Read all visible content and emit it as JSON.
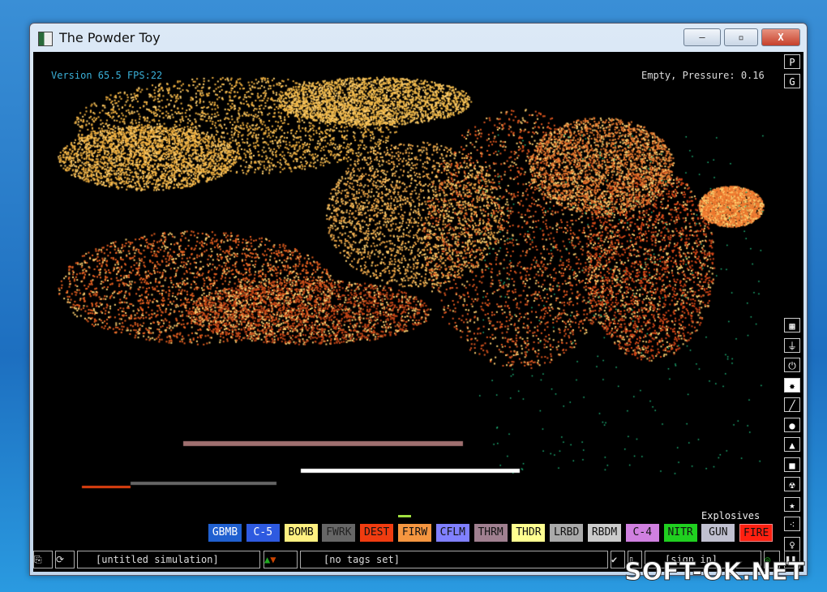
{
  "window": {
    "title": "The Powder Toy",
    "minimize": "–",
    "maximize": "▫",
    "close": "X"
  },
  "hud": {
    "version": "Version 65.5 FPS:22",
    "status": "Empty, Pressure: 0.16"
  },
  "side_top": [
    "P",
    "G"
  ],
  "side_tools": [
    {
      "icon": "wall-icon",
      "glyph": "▦"
    },
    {
      "icon": "electronics-plug-icon",
      "glyph": "⏚"
    },
    {
      "icon": "power-icon",
      "glyph": "⏻"
    },
    {
      "icon": "explosives-icon",
      "glyph": "✸"
    },
    {
      "icon": "gas-pen-icon",
      "glyph": "╱"
    },
    {
      "icon": "liquid-drop-icon",
      "glyph": "●"
    },
    {
      "icon": "powder-icon",
      "glyph": "▲"
    },
    {
      "icon": "solid-icon",
      "glyph": "■"
    },
    {
      "icon": "radioactive-icon",
      "glyph": "☢"
    },
    {
      "icon": "special-star-icon",
      "glyph": "★"
    },
    {
      "icon": "particles-icon",
      "glyph": "⁖"
    },
    {
      "icon": "life-icon",
      "glyph": "♀"
    }
  ],
  "category": "Explosives",
  "elements": [
    {
      "label": "GBMB",
      "bg": "#2060d0",
      "fg": "#ffffff"
    },
    {
      "label": "C-5",
      "bg": "#2e5ae0",
      "fg": "#ffffff"
    },
    {
      "label": "BOMB",
      "bg": "#fff080",
      "fg": "#000000"
    },
    {
      "label": "FWRK",
      "bg": "#666666",
      "fg": "#222222"
    },
    {
      "label": "DEST",
      "bg": "#f03c10",
      "fg": "#111111"
    },
    {
      "label": "FIRW",
      "bg": "#f59640",
      "fg": "#111111"
    },
    {
      "label": "CFLM",
      "bg": "#8080ff",
      "fg": "#111111"
    },
    {
      "label": "THRM",
      "bg": "#a08090",
      "fg": "#111111"
    },
    {
      "label": "THDR",
      "bg": "#ffff90",
      "fg": "#111111"
    },
    {
      "label": "LRBD",
      "bg": "#aaaaaa",
      "fg": "#111111"
    },
    {
      "label": "RBDM",
      "bg": "#cccccc",
      "fg": "#111111"
    },
    {
      "label": "C-4",
      "bg": "#d080e0",
      "fg": "#111111"
    },
    {
      "label": "NITR",
      "bg": "#20d020",
      "fg": "#111111"
    },
    {
      "label": "GUN",
      "bg": "#c0c0d0",
      "fg": "#111111"
    },
    {
      "label": "FIRE",
      "bg": "#ff2010",
      "fg": "#111111"
    }
  ],
  "bottom": {
    "sim_name": "[untitled simulation]",
    "tags": "[no tags set]",
    "sign_in": "[sign in]"
  },
  "watermark": "SOFT-OK.NET"
}
